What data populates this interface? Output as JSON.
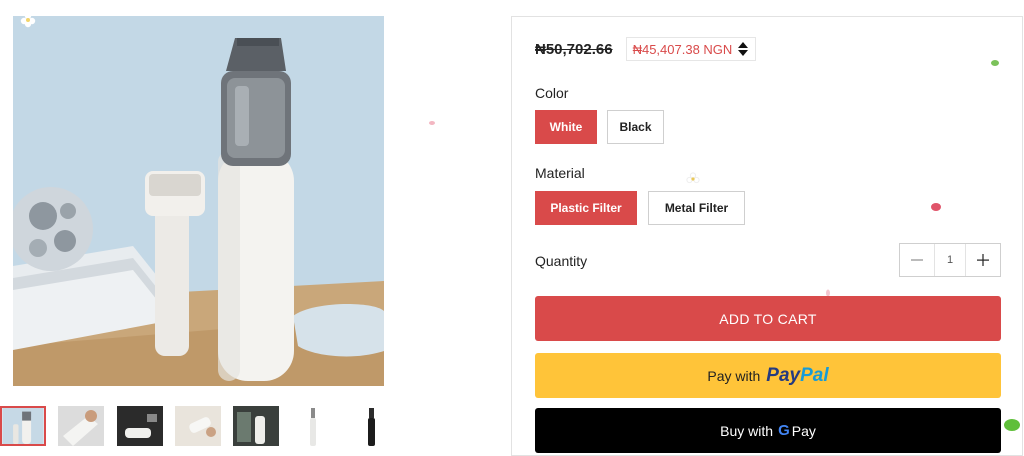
{
  "product": {
    "old_price": "₦50,702.66",
    "new_price": "₦45,407.38 NGN",
    "currency_toggle_icon": "sort-updown-icon"
  },
  "options": {
    "color": {
      "label": "Color",
      "values": [
        "White",
        "Black"
      ],
      "selected": "White"
    },
    "material": {
      "label": "Material",
      "values": [
        "Plastic Filter",
        "Metal Filter"
      ],
      "selected": "Plastic Filter"
    }
  },
  "quantity": {
    "label": "Quantity",
    "value": "1",
    "minus_icon": "minus-icon",
    "plus_icon": "plus-icon"
  },
  "buttons": {
    "add_to_cart": "ADD TO CART",
    "paypal_prefix": "Pay with",
    "paypal_word_a": "Pay",
    "paypal_word_b": "Pal",
    "gpay_prefix": "Buy with",
    "gpay_g": "G",
    "gpay_suffix": "Pay"
  },
  "gallery": {
    "thumbnail_count": 7,
    "active_index": 0
  },
  "colors": {
    "accent": "#d94a4a",
    "paypal_yellow": "#ffc439",
    "paypal_navy": "#253b80",
    "paypal_blue": "#179bd7",
    "gpay_black": "#000000"
  }
}
